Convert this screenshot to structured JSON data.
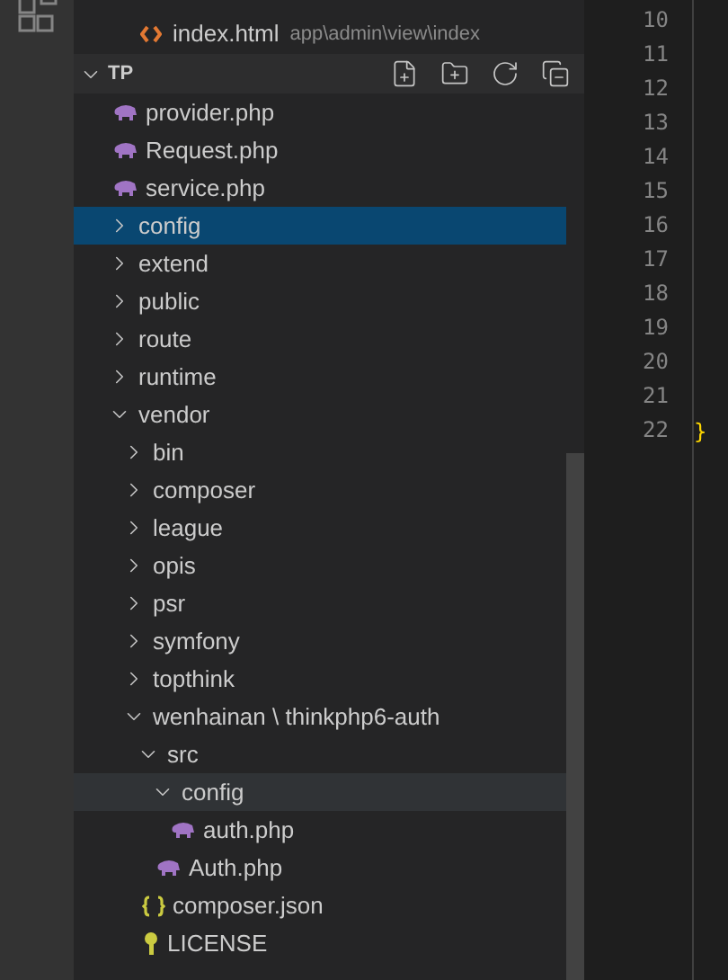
{
  "open_editors": [
    {
      "name": "index.html",
      "kind": "html",
      "description": "app\\admin\\view\\index"
    }
  ],
  "explorer": {
    "title": "TP",
    "expanded": true,
    "tree": [
      {
        "name": "provider.php",
        "kind": "php",
        "selected": false
      },
      {
        "name": "Request.php",
        "kind": "php",
        "selected": false
      },
      {
        "name": "service.php",
        "kind": "php",
        "selected": false
      },
      {
        "name": "config",
        "kind": "folder",
        "expanded": false,
        "selected": true
      },
      {
        "name": "extend",
        "kind": "folder",
        "expanded": false,
        "selected": false
      },
      {
        "name": "public",
        "kind": "folder",
        "expanded": false,
        "selected": false
      },
      {
        "name": "route",
        "kind": "folder",
        "expanded": false,
        "selected": false
      },
      {
        "name": "runtime",
        "kind": "folder",
        "expanded": false,
        "selected": false
      },
      {
        "name": "vendor",
        "kind": "folder",
        "expanded": true,
        "selected": false,
        "children": [
          {
            "name": "bin",
            "kind": "folder",
            "expanded": false,
            "selected": false
          },
          {
            "name": "composer",
            "kind": "folder",
            "expanded": false,
            "selected": false
          },
          {
            "name": "league",
            "kind": "folder",
            "expanded": false,
            "selected": false
          },
          {
            "name": "opis",
            "kind": "folder",
            "expanded": false,
            "selected": false
          },
          {
            "name": "psr",
            "kind": "folder",
            "expanded": false,
            "selected": false
          },
          {
            "name": "symfony",
            "kind": "folder",
            "expanded": false,
            "selected": false
          },
          {
            "name": "topthink",
            "kind": "folder",
            "expanded": false,
            "selected": false
          },
          {
            "name": "wenhainan \\ thinkphp6-auth",
            "kind": "folder",
            "expanded": true,
            "selected": false,
            "children": [
              {
                "name": "src",
                "kind": "folder",
                "expanded": true,
                "selected": false,
                "children": [
                  {
                    "name": "config",
                    "kind": "folder",
                    "expanded": true,
                    "selected": false,
                    "hovered": true,
                    "children": [
                      {
                        "name": "auth.php",
                        "kind": "php",
                        "selected": false
                      }
                    ]
                  },
                  {
                    "name": "Auth.php",
                    "kind": "php",
                    "selected": false
                  }
                ]
              },
              {
                "name": "composer.json",
                "kind": "json",
                "selected": false
              },
              {
                "name": "LICENSE",
                "kind": "license",
                "selected": false
              }
            ]
          }
        ]
      }
    ]
  },
  "lines": [
    {
      "number": "10"
    },
    {
      "number": "11"
    },
    {
      "number": "12"
    },
    {
      "number": "13"
    },
    {
      "number": "14"
    },
    {
      "number": "15"
    },
    {
      "number": "16"
    },
    {
      "number": "17"
    },
    {
      "number": "18"
    },
    {
      "number": "19"
    },
    {
      "number": "20"
    },
    {
      "number": "21"
    },
    {
      "number": "22",
      "code": "}"
    }
  ]
}
